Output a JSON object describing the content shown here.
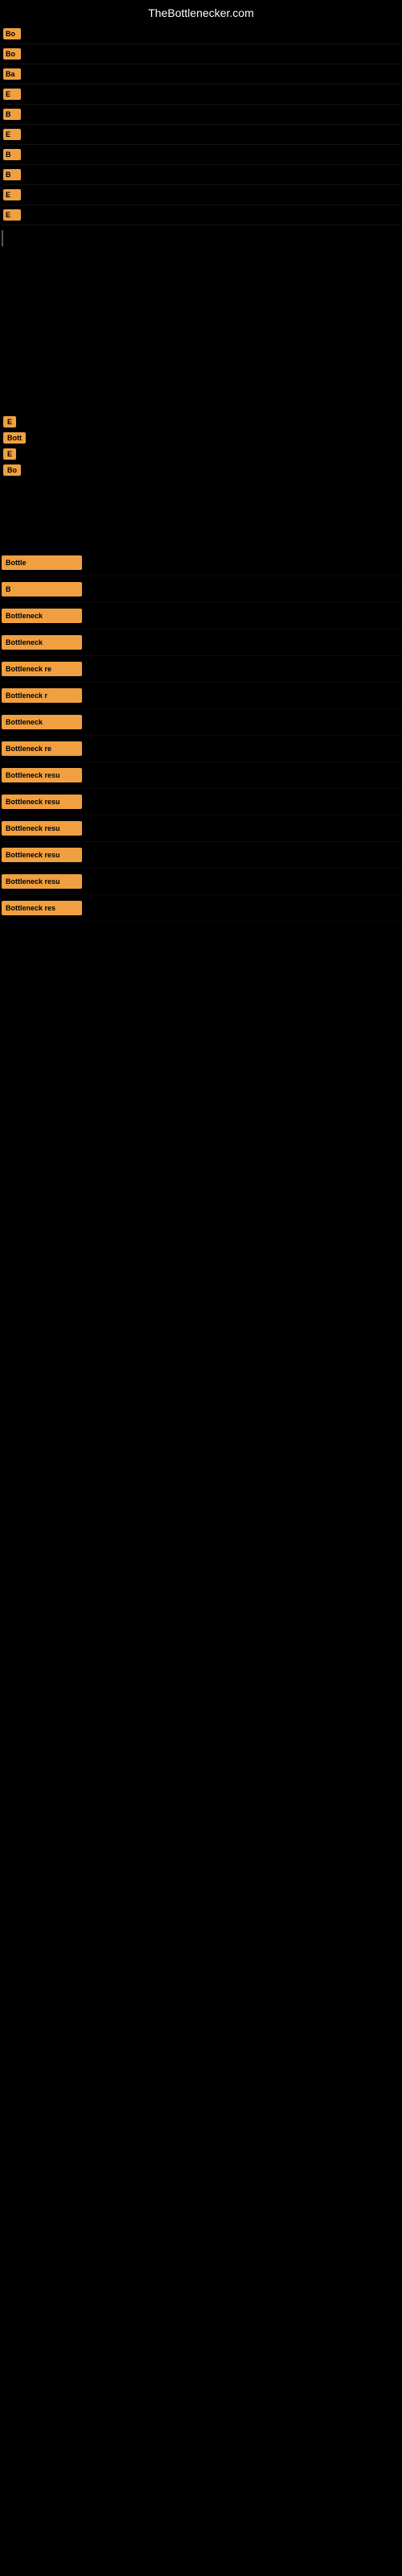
{
  "site": {
    "title": "TheBottlenecker.com"
  },
  "topItems": [
    {
      "label": "Bo"
    },
    {
      "label": "Bo"
    },
    {
      "label": "Ba"
    },
    {
      "label": "E"
    },
    {
      "label": "B"
    },
    {
      "label": "E"
    },
    {
      "label": "B"
    },
    {
      "label": "B"
    },
    {
      "label": "E"
    },
    {
      "label": "E"
    }
  ],
  "middleSection": {
    "emptyLabel": "E",
    "bottLabel": "Bott",
    "eLabel": "E",
    "boLabel": "Bo"
  },
  "bottomResults": [
    {
      "label": "Bottle"
    },
    {
      "label": "B"
    },
    {
      "label": "Bottleneck"
    },
    {
      "label": "Bottleneck"
    },
    {
      "label": "Bottleneck re"
    },
    {
      "label": "Bottleneck r"
    },
    {
      "label": "Bottleneck"
    },
    {
      "label": "Bottleneck re"
    },
    {
      "label": "Bottleneck resu"
    },
    {
      "label": "Bottleneck resu"
    },
    {
      "label": "Bottleneck resu"
    },
    {
      "label": "Bottleneck resu"
    },
    {
      "label": "Bottleneck resu"
    },
    {
      "label": "Bottleneck res"
    }
  ]
}
